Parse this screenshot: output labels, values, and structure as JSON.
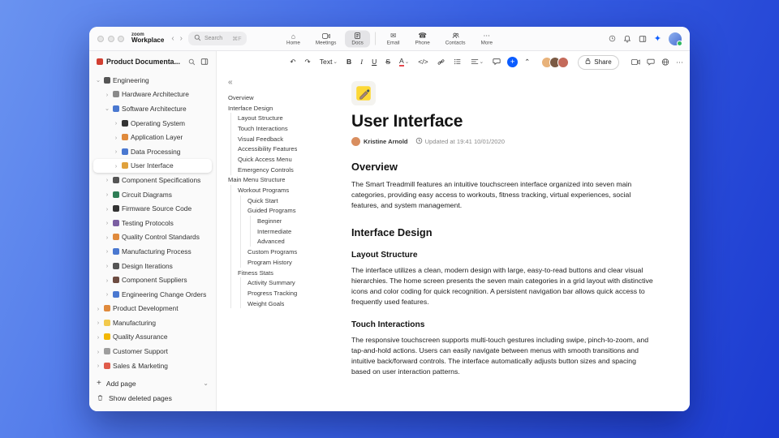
{
  "colors": {
    "accent": "#0b5cff"
  },
  "titlebar": {
    "brand_top": "zoom",
    "brand_bottom": "Workplace",
    "nav_back": "‹",
    "nav_forward": "›",
    "search_placeholder": "Search",
    "search_shortcut": "⌘F",
    "tabs": [
      {
        "label": "Home",
        "icon": "home"
      },
      {
        "label": "Meetings",
        "icon": "meetings"
      },
      {
        "label": "Docs",
        "icon": "docs",
        "active": true
      },
      {
        "label": "Email",
        "icon": "email",
        "sep_before": true
      },
      {
        "label": "Phone",
        "icon": "phone"
      },
      {
        "label": "Contacts",
        "icon": "contacts"
      },
      {
        "label": "More",
        "icon": "more"
      }
    ],
    "actions": [
      {
        "name": "clock"
      },
      {
        "name": "bell"
      },
      {
        "name": "side-panel"
      },
      {
        "name": "ai-companion",
        "accent": true
      }
    ]
  },
  "sidebar": {
    "header": {
      "title": "Product Documenta...",
      "icon_color": "#d23f31"
    },
    "items": [
      {
        "label": "Engineering",
        "level": 0,
        "expanded": true,
        "icon_color": "#555555"
      },
      {
        "label": "Hardware Architecture",
        "level": 1,
        "icon_color": "#8a8a8a"
      },
      {
        "label": "Software Architecture",
        "level": 1,
        "expanded": true,
        "icon_color": "#4a78d0"
      },
      {
        "label": "Operating System",
        "level": 2,
        "icon_color": "#333333"
      },
      {
        "label": "Application Layer",
        "level": 2,
        "icon_color": "#e08a3c"
      },
      {
        "label": "Data Processing",
        "level": 2,
        "icon_color": "#4a78d0"
      },
      {
        "label": "User Interface",
        "level": 2,
        "selected": true,
        "icon_color": "#e0a13c"
      },
      {
        "label": "Component Specifications",
        "level": 1,
        "icon_color": "#555555"
      },
      {
        "label": "Circuit Diagrams",
        "level": 1,
        "icon_color": "#2e7d55"
      },
      {
        "label": "Firmware Source Code",
        "level": 1,
        "icon_color": "#333333"
      },
      {
        "label": "Testing Protocols",
        "level": 1,
        "icon_color": "#7b5fa2"
      },
      {
        "label": "Quality Control Standards",
        "level": 1,
        "icon_color": "#e08a3c"
      },
      {
        "label": "Manufacturing Process",
        "level": 1,
        "icon_color": "#4a78d0"
      },
      {
        "label": "Design Iterations",
        "level": 1,
        "icon_color": "#555555"
      },
      {
        "label": "Component Suppliers",
        "level": 1,
        "icon_color": "#6d4c41"
      },
      {
        "label": "Engineering Change Orders",
        "level": 1,
        "icon_color": "#4a78d0"
      },
      {
        "label": "Product Development",
        "level": 0,
        "icon_color": "#e08a3c"
      },
      {
        "label": "Manufacturing",
        "level": 0,
        "icon_color": "#f2c94c"
      },
      {
        "label": "Quality Assurance",
        "level": 0,
        "icon_color": "#f2b705"
      },
      {
        "label": "Customer Support",
        "level": 0,
        "icon_color": "#9e9e9e"
      },
      {
        "label": "Sales & Marketing",
        "level": 0,
        "icon_color": "#e05c4b"
      }
    ],
    "footer": {
      "add_label": "Add page",
      "deleted_label": "Show deleted pages"
    }
  },
  "toolbar": {
    "buttons": [
      {
        "name": "undo"
      },
      {
        "name": "redo"
      },
      {
        "name": "text-style",
        "label": "Text",
        "dropdown": true
      },
      {
        "name": "bold"
      },
      {
        "name": "italic"
      },
      {
        "name": "underline"
      },
      {
        "name": "strikethrough"
      },
      {
        "name": "text-color",
        "label": "A",
        "dropdown": true
      },
      {
        "name": "code"
      },
      {
        "name": "link"
      },
      {
        "name": "bullet-list"
      },
      {
        "name": "align",
        "dropdown": true
      },
      {
        "name": "comment"
      },
      {
        "name": "insert",
        "accent": true
      },
      {
        "name": "collapse-toolbar"
      }
    ],
    "collaborators": [
      {
        "color": "#e8b27a"
      },
      {
        "color": "#7a5a44"
      },
      {
        "color": "#c46a5a"
      }
    ],
    "share_label": "Share",
    "far_actions": [
      {
        "name": "video"
      },
      {
        "name": "chat"
      },
      {
        "name": "web"
      },
      {
        "name": "more-h"
      }
    ]
  },
  "outline": {
    "collapse_glyph": "«",
    "items": [
      {
        "label": "Overview",
        "level": 0
      },
      {
        "label": "Interface Design",
        "level": 0
      },
      {
        "label": "Layout Structure",
        "level": 1
      },
      {
        "label": "Touch Interactions",
        "level": 1
      },
      {
        "label": "Visual Feedback",
        "level": 1
      },
      {
        "label": "Accessibility Features",
        "level": 1
      },
      {
        "label": "Quick Access Menu",
        "level": 1
      },
      {
        "label": "Emergency Controls",
        "level": 1
      },
      {
        "label": "Main Menu Structure",
        "level": 0
      },
      {
        "label": "Workout Programs",
        "level": 1
      },
      {
        "label": "Quick Start",
        "level": 2
      },
      {
        "label": "Guided Programs",
        "level": 2
      },
      {
        "label": "Beginner",
        "level": 3
      },
      {
        "label": "Intermediate",
        "level": 3
      },
      {
        "label": "Advanced",
        "level": 3
      },
      {
        "label": "Custom Programs",
        "level": 2
      },
      {
        "label": "Program History",
        "level": 2
      },
      {
        "label": "Fitness Stats",
        "level": 1
      },
      {
        "label": "Activity Summary",
        "level": 2
      },
      {
        "label": "Progress Tracking",
        "level": 2
      },
      {
        "label": "Weight Goals",
        "level": 2
      }
    ]
  },
  "doc": {
    "title": "User Interface",
    "author": "Kristine Arnold",
    "updated": "Updated at 19:41 10/01/2020",
    "sections": [
      {
        "type": "h2",
        "text": "Overview"
      },
      {
        "type": "p",
        "text": "The Smart Treadmill features an intuitive touchscreen interface organized into seven main categories, providing easy access to workouts, fitness tracking, virtual experiences, social features, and system management."
      },
      {
        "type": "h2",
        "text": "Interface Design"
      },
      {
        "type": "h3",
        "text": "Layout Structure"
      },
      {
        "type": "p",
        "text": "The interface utilizes a clean, modern design with large, easy-to-read buttons and clear visual hierarchies. The home screen presents the seven main categories in a grid layout with distinctive icons and color coding for quick recognition. A persistent navigation bar allows quick access to frequently used features."
      },
      {
        "type": "h3",
        "text": "Touch Interactions"
      },
      {
        "type": "p",
        "text": "The responsive touchscreen supports multi-touch gestures including swipe, pinch-to-zoom, and tap-and-hold actions. Users can easily navigate between menus with smooth transitions and intuitive back/forward controls. The interface automatically adjusts button sizes and spacing based on user interaction patterns."
      }
    ]
  }
}
